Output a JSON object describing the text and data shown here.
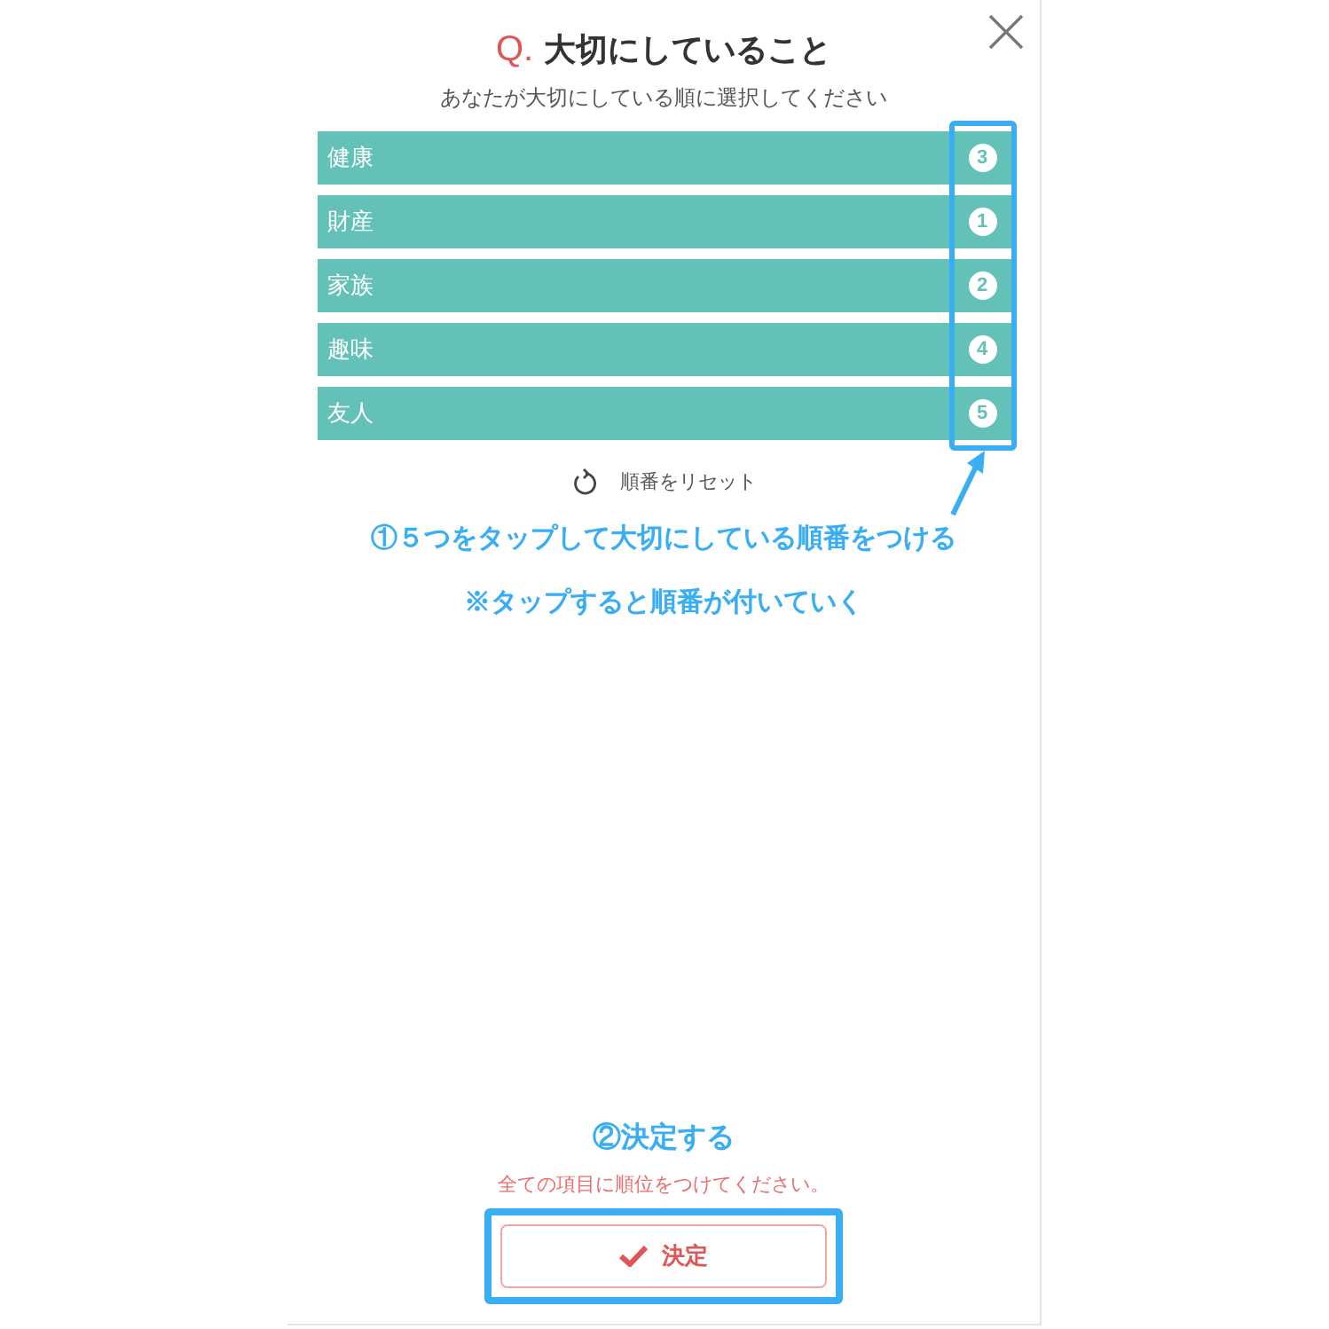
{
  "dialog": {
    "title_mark": "Q.",
    "title": "大切にしていること",
    "subtitle": "あなたが大切にしている順に選択してください"
  },
  "items": [
    {
      "label": "健康",
      "rank": "3"
    },
    {
      "label": "財産",
      "rank": "1"
    },
    {
      "label": "家族",
      "rank": "2"
    },
    {
      "label": "趣味",
      "rank": "4"
    },
    {
      "label": "友人",
      "rank": "5"
    }
  ],
  "reset_label": "順番をリセット",
  "error_message": "全ての項目に順位をつけてください。",
  "submit_button": "決定",
  "annotations": [
    "①５つをタップして大切にしている順番をつける",
    "※タップすると順番が付いていく",
    "②決定する"
  ]
}
